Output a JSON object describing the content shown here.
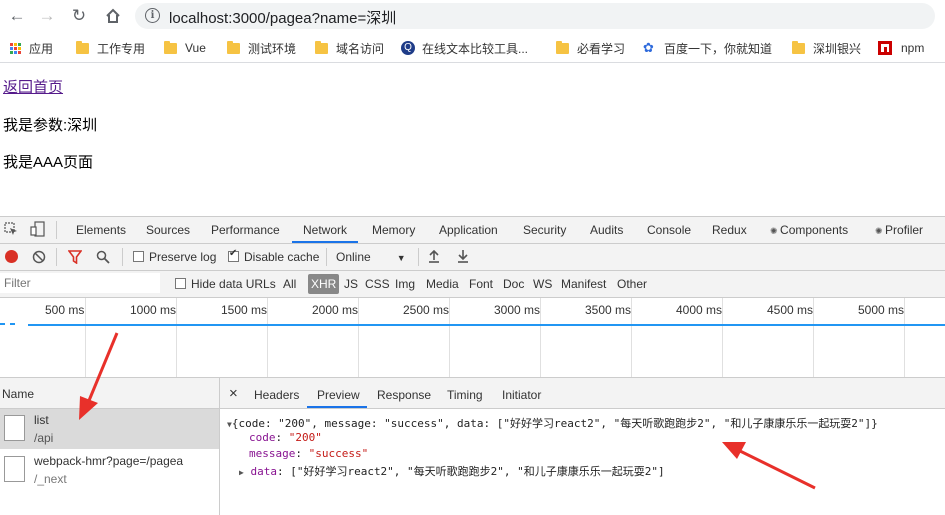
{
  "browser": {
    "url": "localhost:3000/pagea?name=深圳",
    "bookmarks": [
      "应用",
      "工作专用",
      "Vue",
      "测试环境",
      "域名访问",
      "在线文本比较工具...",
      "必看学习",
      "百度一下，你就知道",
      "深圳银兴",
      "npm"
    ]
  },
  "page": {
    "back_link": "返回首页",
    "param_text": "我是参数:深圳",
    "title": "我是AAA页面"
  },
  "devtools": {
    "tabs": [
      "Elements",
      "Sources",
      "Performance",
      "Network",
      "Memory",
      "Application",
      "Security",
      "Audits",
      "Console",
      "Redux",
      "Components",
      "Profiler"
    ],
    "active_tab": "Network",
    "toolbar": {
      "preserve_log": "Preserve log",
      "disable_cache": "Disable cache",
      "throttle": "Online"
    },
    "filter": {
      "placeholder": "Filter",
      "hide_data_urls": "Hide data URLs",
      "types": [
        "All",
        "XHR",
        "JS",
        "CSS",
        "Img",
        "Media",
        "Font",
        "Doc",
        "WS",
        "Manifest",
        "Other"
      ]
    },
    "timeline_ticks": [
      "500 ms",
      "1000 ms",
      "1500 ms",
      "2000 ms",
      "2500 ms",
      "3000 ms",
      "3500 ms",
      "4000 ms",
      "4500 ms",
      "5000 ms"
    ],
    "requests": {
      "header": "Name",
      "rows": [
        {
          "name": "list",
          "path": "/api"
        },
        {
          "name": "webpack-hmr?page=/pagea",
          "path": "/_next"
        }
      ]
    },
    "detail": {
      "close": "×",
      "tabs": [
        "Headers",
        "Preview",
        "Response",
        "Timing",
        "Initiator"
      ],
      "active_tab": "Preview",
      "preview": {
        "summary": "{code: \"200\", message: \"success\", data: [\"好好学习react2\", \"每天听歌跑跑步2\", \"和儿子康康乐乐一起玩耍2\"]}",
        "code_key": "code",
        "code_val": "\"200\"",
        "message_key": "message",
        "message_val": "\"success\"",
        "data_key": "data",
        "data_val": "[\"好好学习react2\", \"每天听歌跑跑步2\", \"和儿子康康乐乐一起玩耍2\"]"
      }
    }
  }
}
